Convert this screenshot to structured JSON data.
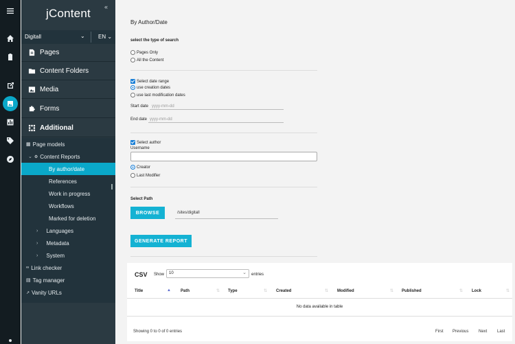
{
  "rail": {
    "icons": [
      "menu-icon",
      "home-icon",
      "clipboard-icon",
      "export-icon",
      "image-icon",
      "chart-icon",
      "tag-icon",
      "compass-icon"
    ]
  },
  "sidebar": {
    "brand": "jContent",
    "collapse": "«",
    "site": "Digitall",
    "language": "EN",
    "menu": [
      {
        "label": "Pages",
        "icon": "file-icon"
      },
      {
        "label": "Content Folders",
        "icon": "folder-icon"
      },
      {
        "label": "Media",
        "icon": "image-icon"
      },
      {
        "label": "Forms",
        "icon": "puzzle-icon"
      },
      {
        "label": "Additional",
        "icon": "grid-icon"
      }
    ],
    "tree": [
      {
        "label": "Page models"
      },
      {
        "label": "Content Reports"
      },
      {
        "label": "By author/date"
      },
      {
        "label": "References"
      },
      {
        "label": "Work in progress"
      },
      {
        "label": "Workflows"
      },
      {
        "label": "Marked for deletion"
      },
      {
        "label": "Languages"
      },
      {
        "label": "Metadata"
      },
      {
        "label": "System"
      },
      {
        "label": "Link checker"
      },
      {
        "label": "Tag manager"
      },
      {
        "label": "Vanity URLs"
      }
    ]
  },
  "main": {
    "title": "By Author/Date",
    "search_type_label": "select the type of search",
    "opt_pages_only": "Pages Only",
    "opt_all_content": "All the Content",
    "date_range_label": "Select date range",
    "opt_creation_dates": "use creation dates",
    "opt_modification_dates": "use last modification dates",
    "start_date_label": "Start date",
    "end_date_label": "End date",
    "date_placeholder": "yyyy-mm-dd",
    "select_author_label": "Select author",
    "username_label": "Username",
    "username_value": "",
    "opt_creator": "Creator",
    "opt_last_modifier": "Last Modifier",
    "select_path_label": "Select Path",
    "browse_button": "BROWSE",
    "path_value": "/sites/digitall",
    "generate_button": "GENERATE REPORT"
  },
  "table": {
    "title": "CSV",
    "show_label": "Show",
    "page_size": "10",
    "entries_label": "entries",
    "columns": [
      "Title",
      "Path",
      "Type",
      "Created",
      "Modified",
      "Published",
      "Lock"
    ],
    "empty_message": "No data available in table",
    "info": "Showing 0 to 0 of 0 entries",
    "pager": [
      "First",
      "Previous",
      "Next",
      "Last"
    ]
  },
  "colors": {
    "accent": "#14b2d3",
    "rail": "#131c21",
    "sidebar": "#2b3a42",
    "selected": "#0aa8c9"
  }
}
